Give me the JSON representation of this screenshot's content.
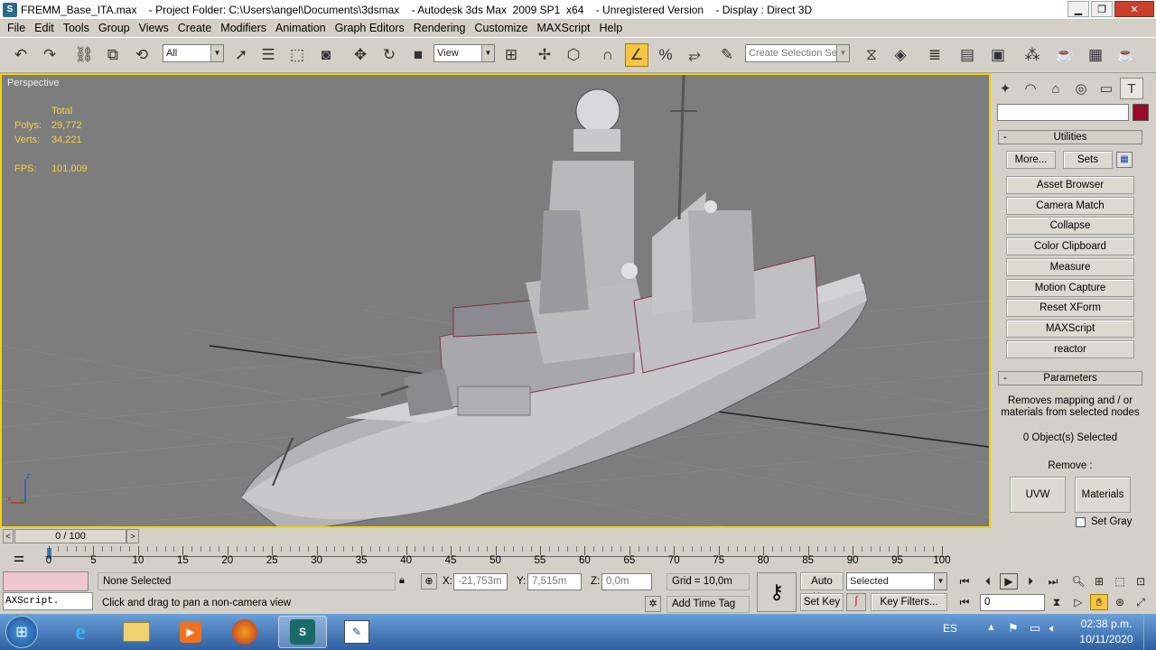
{
  "window": {
    "title": "FREMM_Base_ITA.max    - Project Folder: C:\\Users\\angel\\Documents\\3dsmax    - Autodesk 3ds Max  2009 SP1  x64    - Unregistered Version    - Display : Direct 3D",
    "app_icon": "3dsmax-icon"
  },
  "menu": [
    "File",
    "Edit",
    "Tools",
    "Group",
    "Views",
    "Create",
    "Modifiers",
    "Animation",
    "Graph Editors",
    "Rendering",
    "Customize",
    "MAXScript",
    "Help"
  ],
  "toolbar": {
    "selection_filter": "All",
    "ref_coord": "View",
    "named_selection_placeholder": "Create Selection Set"
  },
  "viewport": {
    "label": "Perspective",
    "stats": {
      "total_label": "Total",
      "polys_label": "Polys:",
      "polys": "29,772",
      "verts_label": "Verts:",
      "verts": "34,221",
      "fps_label": "FPS:",
      "fps": "101,009"
    },
    "axis": {
      "z": "z",
      "x": "x"
    }
  },
  "command_panel": {
    "accent_color": "#9a0a2a",
    "utilities": {
      "header": "Utilities",
      "more": "More...",
      "sets": "Sets",
      "buttons": [
        "Asset Browser",
        "Camera Match",
        "Collapse",
        "Color Clipboard",
        "Measure",
        "Motion Capture",
        "Reset XForm",
        "MAXScript",
        "reactor"
      ]
    },
    "parameters": {
      "header": "Parameters",
      "description": "Removes mapping and / or materials from selected nodes",
      "selected_count": "0 Object(s) Selected",
      "remove_label": "Remove :",
      "uvw": "UVW",
      "materials": "Materials",
      "set_gray": "Set Gray"
    }
  },
  "timeline": {
    "frame": "0 / 100",
    "ticks": [
      "0",
      "5",
      "10",
      "15",
      "20",
      "25",
      "30",
      "35",
      "40",
      "45",
      "50",
      "55",
      "60",
      "65",
      "70",
      "75",
      "80",
      "85",
      "90",
      "95",
      "100"
    ]
  },
  "status": {
    "script_listener": "AXScript.",
    "selection": "None Selected",
    "prompt": "Click and drag to pan a non-camera view",
    "x_label": "X:",
    "x": "-21,753m",
    "y_label": "Y:",
    "y": "7,515m",
    "z_label": "Z:",
    "z": "0,0m",
    "grid": "Grid = 10,0m",
    "add_time_tag": "Add Time Tag",
    "auto_key": "Auto Key",
    "set_key": "Set Key",
    "key_mode": "Selected",
    "key_filters": "Key Filters...",
    "current_frame": "0"
  },
  "taskbar": {
    "lang": "ES",
    "time": "02:38 p.m.",
    "date": "10/11/2020"
  }
}
